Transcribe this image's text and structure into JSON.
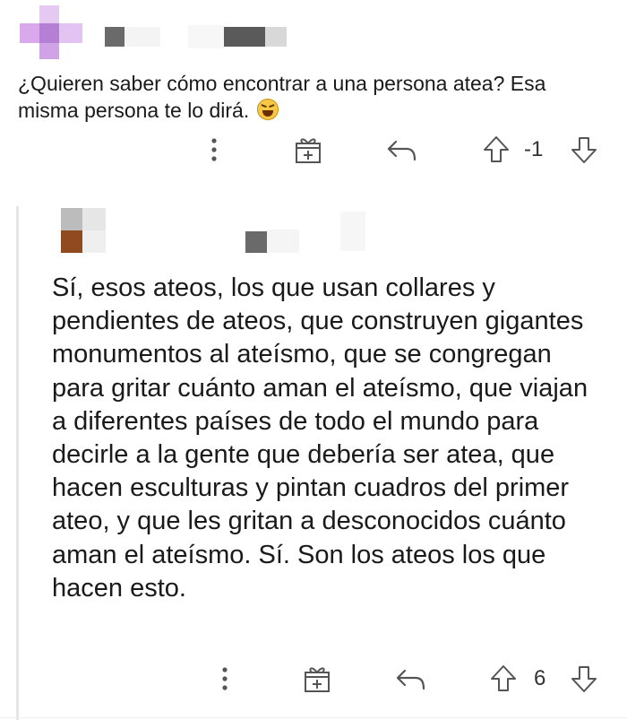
{
  "comment": {
    "text": "¿Quieren saber cómo encontrar a una persona atea? Esa misma persona te lo dirá.",
    "emoji": "laughing-emoji",
    "votes": "-1"
  },
  "reply": {
    "text": "Sí, esos ateos, los que usan collares y pendientes de ateos, que construyen gigantes monumentos al ateísmo, que se congregan para gritar cuánto aman el ateísmo, que viajan a diferentes países de todo el mundo para decirle a la gente que debería ser atea, que hacen esculturas y pintan cuadros del primer ateo, y que les gritan a desconocidos cuánto aman el ateísmo. Sí. Son los ateos los que hacen esto.",
    "votes": "6"
  },
  "icons": {
    "more": "more-vertical-icon",
    "award": "gift-icon",
    "reply": "reply-arrow-icon",
    "upvote": "upvote-arrow-icon",
    "downvote": "downvote-arrow-icon"
  }
}
